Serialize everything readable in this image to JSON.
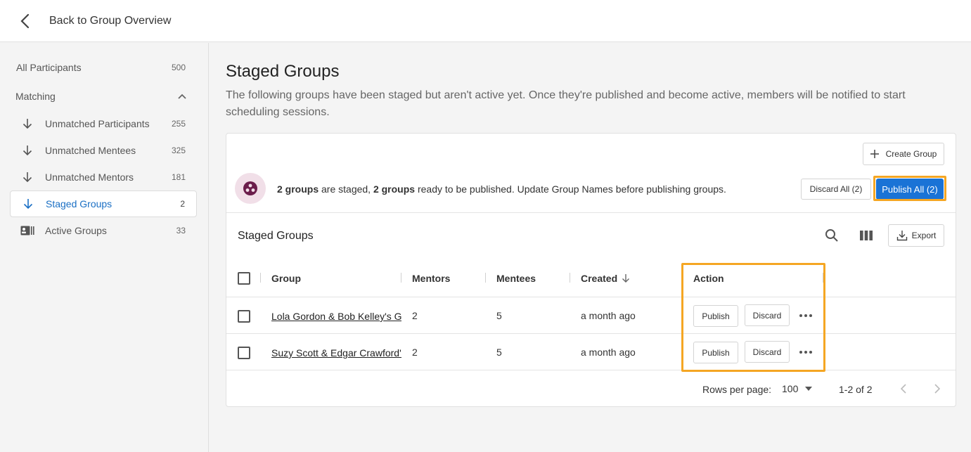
{
  "topbar": {
    "back_label": "Back to Group Overview"
  },
  "sidebar": {
    "all_participants": {
      "label": "All Participants",
      "count": "500"
    },
    "section_label": "Matching",
    "items": [
      {
        "label": "Unmatched Participants",
        "count": "255",
        "icon": "arrow-down-icon"
      },
      {
        "label": "Unmatched Mentees",
        "count": "325",
        "icon": "arrow-down-icon"
      },
      {
        "label": "Unmatched Mentors",
        "count": "181",
        "icon": "arrow-down-icon"
      },
      {
        "label": "Staged Groups",
        "count": "2",
        "icon": "arrow-down-icon",
        "active": true
      },
      {
        "label": "Active Groups",
        "count": "33",
        "icon": "contact-card-icon"
      }
    ]
  },
  "main": {
    "title": "Staged Groups",
    "description": "The following groups have been staged but aren't active yet. Once they're published and become active, members will be notified to start scheduling sessions."
  },
  "card": {
    "create_group_label": "Create Group",
    "banner": {
      "count_a": "2 groups",
      "text_a": " are staged, ",
      "count_b": "2 groups",
      "text_b": " ready to be published. Update Group Names before publishing groups."
    },
    "discard_all_label": "Discard All (2)",
    "publish_all_label": "Publish All (2)",
    "table_title": "Staged Groups",
    "export_label": "Export",
    "columns": [
      "Group",
      "Mentors",
      "Mentees",
      "Created",
      "Action"
    ],
    "rows": [
      {
        "group": "Lola Gordon & Bob Kelley's Group",
        "mentors": "2",
        "mentees": "5",
        "created": "a month ago",
        "publish": "Publish",
        "discard": "Discard"
      },
      {
        "group": "Suzy Scott & Edgar Crawford's Group",
        "mentors": "2",
        "mentees": "5",
        "created": "a month ago",
        "publish": "Publish",
        "discard": "Discard"
      }
    ],
    "footer": {
      "rows_per_page_label": "Rows per page:",
      "rows_per_page_value": "100",
      "range": "1-2 of 2"
    }
  },
  "colors": {
    "accent": "#1a73d6",
    "highlight": "#f5a623",
    "banner_icon_bg": "#f1dfe8",
    "banner_icon_fg": "#6b1d4b"
  }
}
